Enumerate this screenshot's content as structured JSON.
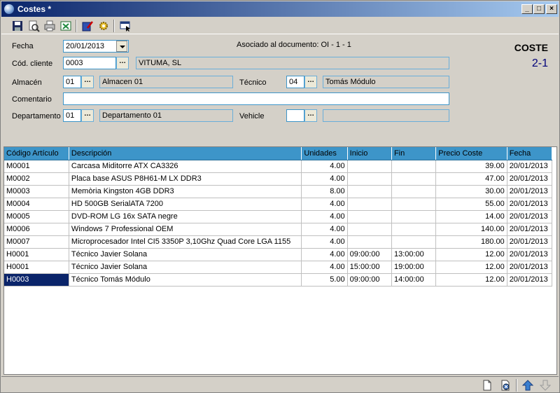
{
  "window": {
    "title": "Costes *"
  },
  "form": {
    "fecha_label": "Fecha",
    "fecha_value": "20/01/2013",
    "asociado_text": "Asociado al documento: OI - 1 - 1",
    "doc_type": "COSTE",
    "doc_number": "2-1",
    "cliente_label": "Cód. cliente",
    "cliente_code": "0003",
    "cliente_name": "VITUMA, SL",
    "almacen_label": "Almacén",
    "almacen_code": "01",
    "almacen_name": "Almacen 01",
    "tecnico_label": "Técnico",
    "tecnico_code": "04",
    "tecnico_name": "Tomás Módulo",
    "comentario_label": "Comentario",
    "comentario_value": "",
    "departamento_label": "Departamento",
    "departamento_code": "01",
    "departamento_name": "Departamento 01",
    "vehicle_label": "Vehicle",
    "vehicle_code": "",
    "vehicle_name": "",
    "dots": "…"
  },
  "grid": {
    "columns": [
      "Código Artículo",
      "Descripción",
      "Unidades",
      "Inicio",
      "Fin",
      "Precio Coste",
      "Fecha"
    ],
    "rows": [
      [
        "M0001",
        "Carcasa Miditorre ATX CA3326",
        "4.00",
        "",
        "",
        "39.00",
        "20/01/2013"
      ],
      [
        "M0002",
        "Placa base ASUS P8H61-M LX DDR3",
        "4.00",
        "",
        "",
        "47.00",
        "20/01/2013"
      ],
      [
        "M0003",
        "Memòria Kingston 4GB DDR3",
        "8.00",
        "",
        "",
        "30.00",
        "20/01/2013"
      ],
      [
        "M0004",
        "HD 500GB SerialATA  7200",
        "4.00",
        "",
        "",
        "55.00",
        "20/01/2013"
      ],
      [
        "M0005",
        "DVD-ROM LG 16x SATA negre",
        "4.00",
        "",
        "",
        "14.00",
        "20/01/2013"
      ],
      [
        "M0006",
        "Windows 7 Professional OEM",
        "4.00",
        "",
        "",
        "140.00",
        "20/01/2013"
      ],
      [
        "M0007",
        "Microprocesador Intel CI5 3350P 3,10Ghz Quad Core LGA 1155",
        "4.00",
        "",
        "",
        "180.00",
        "20/01/2013"
      ],
      [
        "H0001",
        "Técnico Javier Solana",
        "4.00",
        "09:00:00",
        "13:00:00",
        "12.00",
        "20/01/2013"
      ],
      [
        "H0001",
        "Técnico Javier Solana",
        "4.00",
        "15:00:00",
        "19:00:00",
        "12.00",
        "20/01/2013"
      ],
      [
        "H0003",
        "Técnico Tomás Módulo",
        "5.00",
        "09:00:00",
        "14:00:00",
        "12.00",
        "20/01/2013"
      ]
    ],
    "selected_row": 9
  },
  "toolbar_icons": [
    "save-icon",
    "print-preview-icon",
    "print-icon",
    "export-excel-icon",
    "edit-document-icon",
    "settings-gear-icon",
    "select-window-icon"
  ],
  "statusbar_icons": [
    "new-line-icon",
    "delete-line-icon",
    "move-up-icon",
    "move-down-icon"
  ],
  "colors": {
    "header_bg": "#3d95c9",
    "title_bar": "#0a246a",
    "selected": "#0a246a",
    "accent_blue": "#00007a"
  }
}
